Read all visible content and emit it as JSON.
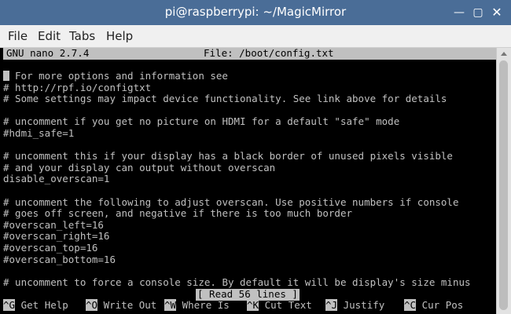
{
  "window": {
    "title": "pi@raspberrypi: ~/MagicMirror",
    "min_glyph": "—",
    "max_glyph": "▢",
    "close_glyph": "✕"
  },
  "menu": [
    "File",
    "Edit",
    "Tabs",
    "Help"
  ],
  "nano": {
    "version": "GNU nano 2.7.4",
    "file": "File: /boot/config.txt",
    "status": "[ Read 56 lines ]"
  },
  "editor": {
    "cursor_line": "For more options and information see",
    "lines": [
      "# http://rpf.io/configtxt",
      "# Some settings may impact device functionality. See link above for details",
      "",
      "# uncomment if you get no picture on HDMI for a default \"safe\" mode",
      "#hdmi_safe=1",
      "",
      "# uncomment this if your display has a black border of unused pixels visible",
      "# and your display can output without overscan",
      "disable_overscan=1",
      "",
      "# uncomment the following to adjust overscan. Use positive numbers if console",
      "# goes off screen, and negative if there is too much border",
      "#overscan_left=16",
      "#overscan_right=16",
      "#overscan_top=16",
      "#overscan_bottom=16",
      "",
      "# uncomment to force a console size. By default it will be display's size minus"
    ]
  },
  "shortcuts": [
    {
      "key": "^G",
      "label": "Get Help"
    },
    {
      "key": "^O",
      "label": "Write Out"
    },
    {
      "key": "^W",
      "label": "Where Is"
    },
    {
      "key": "^K",
      "label": "Cut Text"
    },
    {
      "key": "^J",
      "label": "Justify"
    },
    {
      "key": "^C",
      "label": "Cur Pos"
    }
  ]
}
